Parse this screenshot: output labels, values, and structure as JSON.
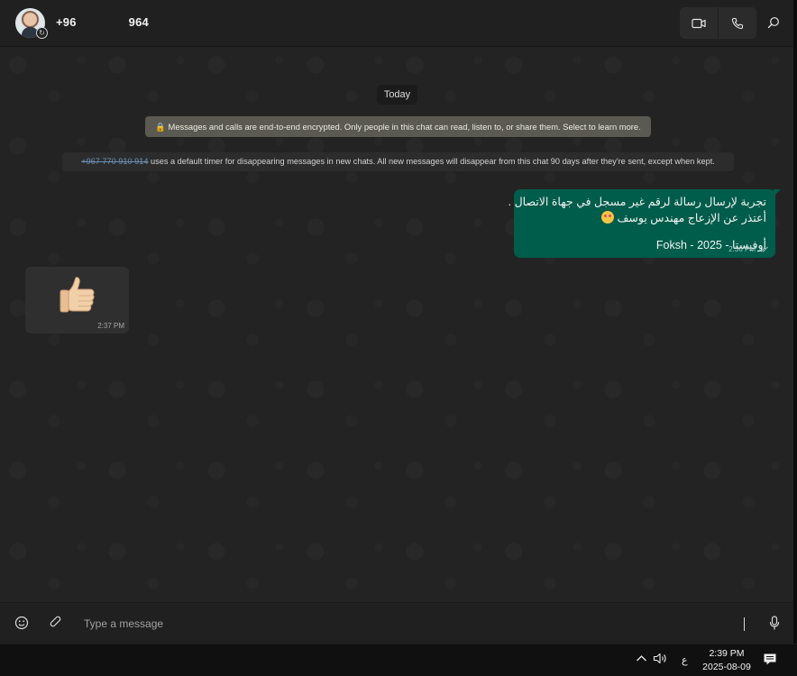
{
  "header": {
    "contact_name_start": "+96",
    "contact_name_end": "964",
    "avatar_badge": "↻"
  },
  "chat": {
    "date_label": "Today",
    "encryption_notice": "🔒 Messages and calls are end-to-end encrypted. Only people in this chat can read, listen to, or share them. Select to learn more.",
    "disappearing_contact": "+967 770 910 914",
    "disappearing_notice": " uses a default timer for disappearing messages in new chats. All new messages will disappear from this chat 90 days after they're sent, except when kept.",
    "messages": [
      {
        "direction": "outgoing",
        "line1": "تجربة لإرسال رسالة لرقم غير مسجل في جهاة الاتصال .",
        "line2": "أعتذر عن الإزعاج مهندس يوسف",
        "line3": "أوفيستا - Foksh - 2025",
        "time": "2:36 PM",
        "status": "read"
      },
      {
        "direction": "incoming",
        "content": "thumbs-up sticker",
        "time": "2:37 PM"
      }
    ]
  },
  "composer": {
    "placeholder": "Type a message",
    "value": ""
  },
  "taskbar": {
    "time": "2:39 PM",
    "date": "2025-08-09",
    "language": "ع"
  },
  "colors": {
    "outgoing_bubble": "#005c4b",
    "incoming_bubble": "#2f2f2f",
    "header_bg": "#202020",
    "chat_bg": "#232323"
  }
}
